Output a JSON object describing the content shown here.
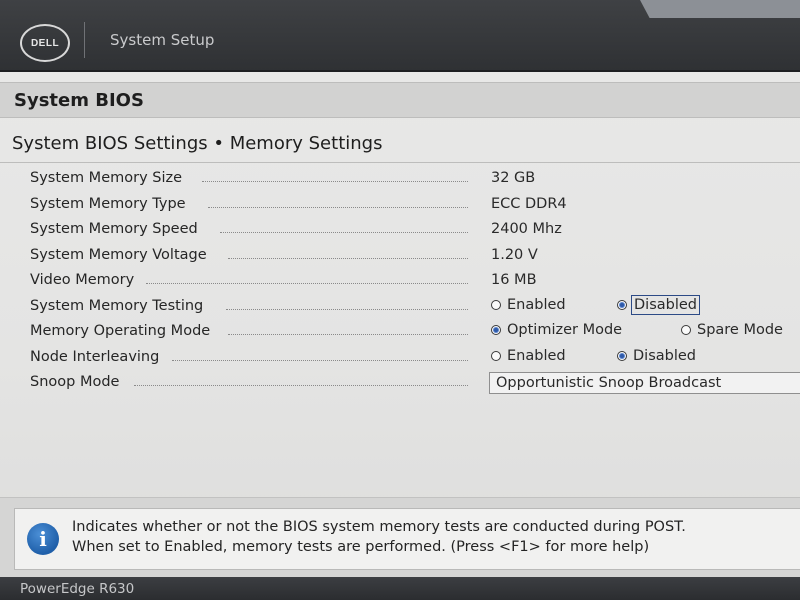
{
  "header": {
    "logo_text": "DELL",
    "app_title": "System Setup"
  },
  "section": {
    "title": "System BIOS",
    "subtitle": "System BIOS Settings • Memory Settings"
  },
  "settings": {
    "memory_size": {
      "label": "System Memory Size",
      "value": "32 GB"
    },
    "memory_type": {
      "label": "System Memory Type",
      "value": "ECC DDR4"
    },
    "memory_speed": {
      "label": "System Memory Speed",
      "value": "2400 Mhz"
    },
    "memory_voltage": {
      "label": "System Memory Voltage",
      "value": "1.20 V"
    },
    "video_memory": {
      "label": "Video Memory",
      "value": "16 MB"
    },
    "memory_testing": {
      "label": "System Memory Testing",
      "options": [
        "Enabled",
        "Disabled"
      ],
      "selected": "Disabled"
    },
    "operating_mode": {
      "label": "Memory Operating Mode",
      "options": [
        "Optimizer Mode",
        "Spare Mode"
      ],
      "selected": "Optimizer Mode"
    },
    "node_interleaving": {
      "label": "Node Interleaving",
      "options": [
        "Enabled",
        "Disabled"
      ],
      "selected": "Disabled"
    },
    "snoop_mode": {
      "label": "Snoop Mode",
      "value": "Opportunistic Snoop Broadcast"
    }
  },
  "help": {
    "icon": "info-icon",
    "line1": "Indicates whether or not the BIOS system memory tests are conducted during POST.",
    "line2": "When set to Enabled, memory tests are performed. (Press <F1> for more help)"
  },
  "footer": {
    "model": "PowerEdge R630"
  },
  "colors": {
    "header_bg": "#2f3134",
    "page_bg": "#e6e6e5",
    "accent": "#2f5aa8",
    "info_icon": "#1f5fa9"
  }
}
